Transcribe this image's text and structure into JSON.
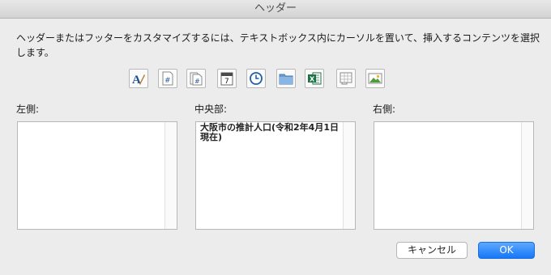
{
  "window": {
    "title": "ヘッダー"
  },
  "instruction": "ヘッダーまたはフッターをカスタマイズするには、テキストボックス内にカーソルを置いて、挿入するコンテンツを選択します。",
  "toolbar": {
    "buttons": [
      {
        "icon": "format-text-icon"
      },
      {
        "icon": "page-number-icon"
      },
      {
        "icon": "page-count-icon"
      },
      {
        "icon": "date-icon",
        "glyph": "7"
      },
      {
        "icon": "time-icon"
      },
      {
        "icon": "file-path-icon"
      },
      {
        "icon": "file-name-icon"
      },
      {
        "icon": "sheet-name-icon"
      },
      {
        "icon": "insert-picture-icon"
      }
    ]
  },
  "sections": {
    "left": {
      "label": "左側:",
      "value": ""
    },
    "center": {
      "label": "中央部:",
      "value": "大阪市の推計人口(令和2年4月1日\n現在)"
    },
    "right": {
      "label": "右側:",
      "value": ""
    }
  },
  "buttons": {
    "cancel": "キャンセル",
    "ok": "OK"
  },
  "colors": {
    "accent": "#1677f7",
    "excel_green": "#1e7145",
    "background": "#ececec"
  }
}
